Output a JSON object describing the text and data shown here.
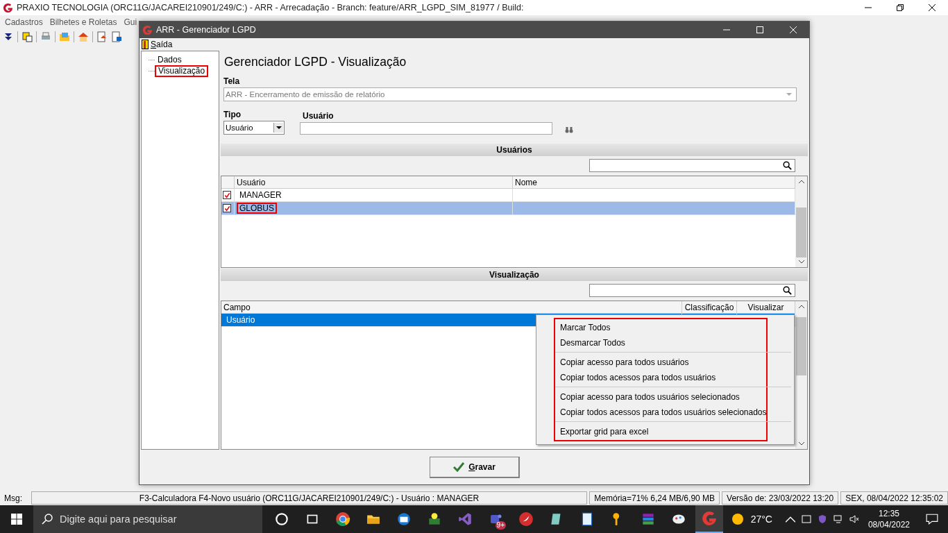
{
  "app": {
    "title": "PRAXIO TECNOLOGIA (ORC11G/JACAREI210901/249/C:) - ARR -  Arrecadação - Branch: feature/ARR_LGPD_SIM_81977 / Build:",
    "menu": [
      "Cadastros",
      "Bilhetes e Roletas",
      "Gui"
    ]
  },
  "dialog": {
    "title": "ARR - Gerenciador LGPD",
    "menu": "Saída",
    "tree": [
      {
        "label": "Dados",
        "highlighted": false
      },
      {
        "label": "Visualização",
        "highlighted": true
      }
    ],
    "heading": "Gerenciador LGPD - Visualização",
    "tela": {
      "label": "Tela",
      "value": "ARR - Encerramento de emissão de relatório",
      "disabled": true
    },
    "tipo": {
      "label": "Tipo",
      "value": "Usuário"
    },
    "usuario": {
      "label": "Usuário"
    },
    "users_section": {
      "title": "Usuários",
      "columns": [
        "Usuário",
        "Nome"
      ],
      "rows": [
        {
          "usuario": "MANAGER",
          "checked": true,
          "selected": false,
          "highlighted": false
        },
        {
          "usuario": "GLOBUS",
          "checked": true,
          "selected": true,
          "highlighted": true
        }
      ]
    },
    "view_section": {
      "title": "Visualização",
      "columns": [
        "Campo",
        "Classificação",
        "Visualizar"
      ],
      "rows": [
        {
          "campo": "Usuário",
          "selected": true
        }
      ]
    },
    "context_menu": {
      "highlighted": true,
      "groups": [
        [
          "Marcar Todos",
          "Desmarcar Todos"
        ],
        [
          "Copiar acesso para todos usuários",
          "Copiar todos acessos para todos usuários"
        ],
        [
          "Copiar acesso para todos usuários selecionados",
          "Copiar todos acessos para todos usuários selecionados"
        ],
        [
          "Exportar grid para excel"
        ]
      ]
    },
    "save_button": "Gravar"
  },
  "status_bar": {
    "label": "Msg:",
    "message": "F3-Calculadora F4-Novo usuário (ORC11G/JACAREI210901/249/C:)  - Usuário : MANAGER",
    "memory": "Memória=71% 6,24 MB/6,90 MB",
    "version": "Versão de: 23/03/2022 13:20",
    "datetime": "SEX, 08/04/2022 12:35:02"
  },
  "taskbar": {
    "search_placeholder": "Digite aqui para pesquisar",
    "badge": "9+",
    "temperature": "27°C",
    "time": "12:35",
    "date": "08/04/2022"
  }
}
